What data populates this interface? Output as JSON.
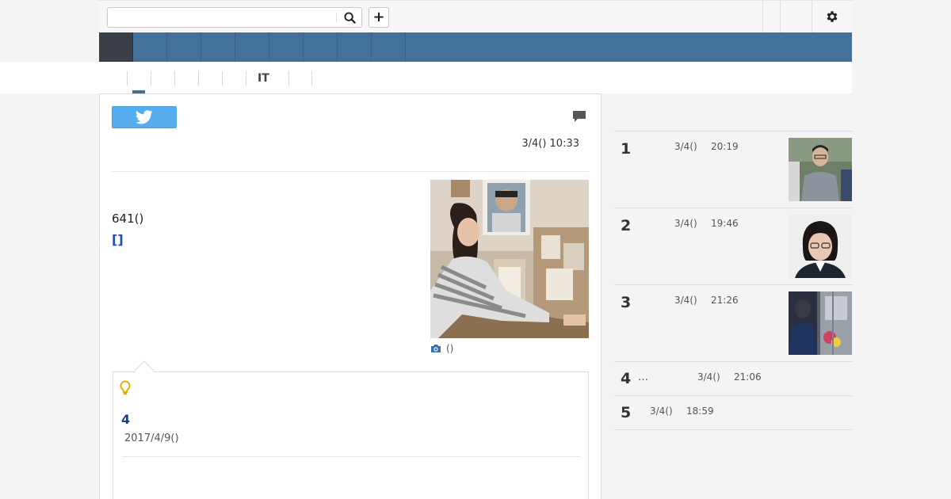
{
  "header": {
    "search": {
      "value": "",
      "placeholder": ""
    },
    "add_label": "+",
    "icons": {
      "search": "search-icon",
      "settings": "gear-icon"
    }
  },
  "nav": {
    "item_count": 9,
    "colors": {
      "bar": "#44719a",
      "home": "#3a3e46"
    }
  },
  "subnav": {
    "items": [
      "",
      "",
      "",
      "",
      "",
      "IT",
      ""
    ],
    "active_index": 0
  },
  "article": {
    "share_icon": "twitter-icon",
    "comment_icon": "comment-icon",
    "date": "3/4() 10:33",
    "body": "641()",
    "link": "[]",
    "photo_caption": "()"
  },
  "related": {
    "icon": "lightbulb-icon",
    "title": "4",
    "date": "2017/4/9()"
  },
  "ranking": [
    {
      "rank": "1",
      "date": "3/4()",
      "time": "20:19",
      "thumb": "photo-man-gray-sweater"
    },
    {
      "rank": "2",
      "date": "3/4()",
      "time": "19:46",
      "thumb": "photo-woman-glasses"
    },
    {
      "rank": "3",
      "date": "3/4()",
      "time": "21:26",
      "thumb": "photo-train-interior"
    },
    {
      "rank": "4",
      "dots": "…",
      "date": "3/4()",
      "time": "21:06"
    },
    {
      "rank": "5",
      "date": "3/4()",
      "time": "18:59"
    }
  ]
}
